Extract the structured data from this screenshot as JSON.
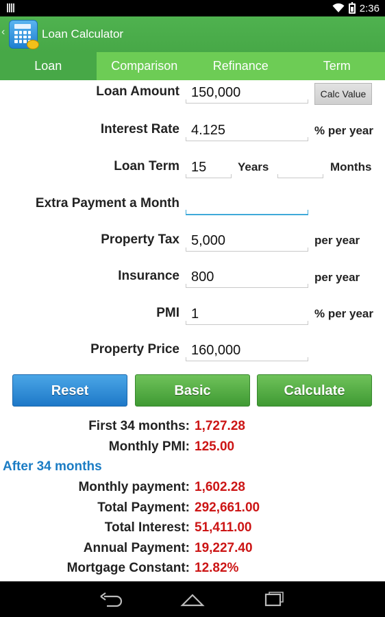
{
  "status_bar": {
    "time": "2:36"
  },
  "app": {
    "title": "Loan Calculator"
  },
  "tabs": [
    {
      "label": "Loan",
      "active": true
    },
    {
      "label": "Comparison",
      "active": false
    },
    {
      "label": "Refinance",
      "active": false
    },
    {
      "label": "Term",
      "active": false
    }
  ],
  "form": {
    "loan_amount": {
      "label": "Loan Amount",
      "value": "150,000",
      "button": "Calc Value"
    },
    "interest_rate": {
      "label": "Interest Rate",
      "value": "4.125",
      "unit": "% per year"
    },
    "loan_term": {
      "label": "Loan Term",
      "years_value": "15",
      "years_unit": "Years",
      "months_value": "",
      "months_unit": "Months"
    },
    "extra_payment": {
      "label": "Extra Payment a Month",
      "value": ""
    },
    "property_tax": {
      "label": "Property Tax",
      "value": "5,000",
      "unit": "per year"
    },
    "insurance": {
      "label": "Insurance",
      "value": "800",
      "unit": "per year"
    },
    "pmi": {
      "label": "PMI",
      "value": "1",
      "unit": "% per year"
    },
    "property_price": {
      "label": "Property Price",
      "value": "160,000"
    }
  },
  "buttons": {
    "reset": "Reset",
    "basic": "Basic",
    "calculate": "Calculate"
  },
  "results": {
    "first": {
      "label": "First 34 months:",
      "value": "1,727.28"
    },
    "monthly_pmi": {
      "label": "Monthly PMI:",
      "value": "125.00"
    },
    "section_title": "After 34 months",
    "monthly_payment": {
      "label": "Monthly payment:",
      "value": "1,602.28"
    },
    "total_payment": {
      "label": "Total Payment:",
      "value": "292,661.00"
    },
    "total_interest": {
      "label": "Total Interest:",
      "value": "51,411.00"
    },
    "annual_payment": {
      "label": "Annual Payment:",
      "value": "19,227.40"
    },
    "mortgage_constant": {
      "label": "Mortgage Constant:",
      "value": "12.82%"
    }
  },
  "colors": {
    "accent_green": "#47a847",
    "tab_green": "#6dcc55",
    "value_red": "#cc1515",
    "section_blue": "#1b7cc4"
  }
}
